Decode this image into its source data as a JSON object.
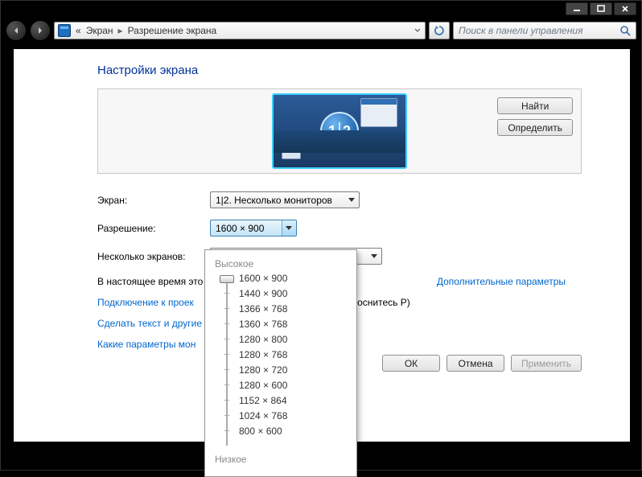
{
  "breadcrumb": {
    "prefix": "«",
    "item1": "Экран",
    "item2": "Разрешение экрана"
  },
  "search": {
    "placeholder": "Поиск в панели управления"
  },
  "page": {
    "title": "Настройки экрана"
  },
  "buttons": {
    "find": "Найти",
    "identify": "Определить",
    "ok": "ОК",
    "cancel": "Отмена",
    "apply": "Применить"
  },
  "labels": {
    "screen": "Экран:",
    "resolution": "Разрешение:",
    "multiple": "Несколько экранов:"
  },
  "selects": {
    "screen_value": "1|2. Несколько мониторов",
    "resolution_value": "1600 × 900"
  },
  "status": {
    "current": "В настоящее время это",
    "advanced": "Дополнительные параметры"
  },
  "links": {
    "projector": "Подключение к проек",
    "projector_hint": "оснитесь P)",
    "text_size": "Сделать текст и другие",
    "which_params": "Какие параметры мон"
  },
  "res_popup": {
    "high": "Высокое",
    "low": "Низкое",
    "values": [
      "1600 × 900",
      "1440 × 900",
      "1366 × 768",
      "1360 × 768",
      "1280 × 800",
      "1280 × 768",
      "1280 × 720",
      "1280 × 600",
      "1152 × 864",
      "1024 × 768",
      "800 × 600"
    ]
  },
  "monitor_badge": {
    "n1": "1",
    "n2": "2"
  }
}
